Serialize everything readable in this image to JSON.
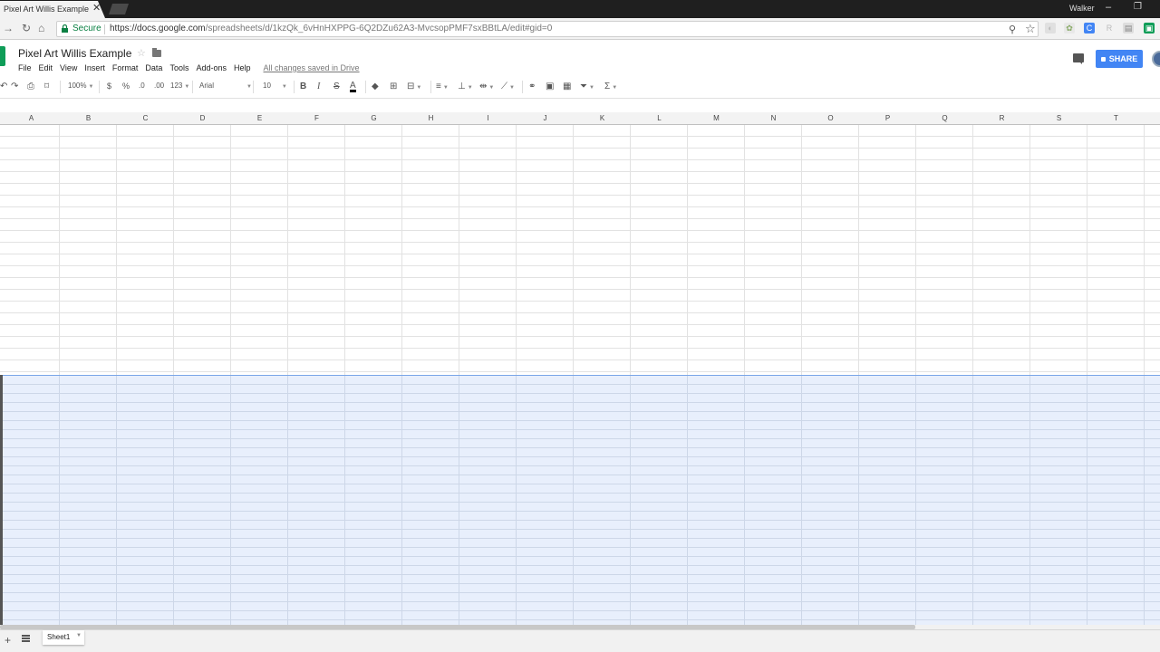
{
  "browser": {
    "tab_title": "Pixel Art Willis Example",
    "tab_close": "✕",
    "profile_name": "Walker",
    "secure_label": "Secure",
    "url_host": "https://docs.google.com",
    "url_path": "/spreadsheets/d/1kzQk_6vHnHXPPG-6Q2DZu62A3-MvcsopPMF7sxBBtLA/edit#gid=0",
    "extensions": [
      {
        "icon": "C",
        "color": "#4285f4"
      },
      {
        "icon": "R",
        "color": "#c8c8c8"
      },
      {
        "icon": "▣",
        "color": "#0f9d58"
      }
    ]
  },
  "doc": {
    "title": "Pixel Art Willis Example",
    "menus": [
      "File",
      "Edit",
      "View",
      "Insert",
      "Format",
      "Data",
      "Tools",
      "Add-ons",
      "Help"
    ],
    "save_status": "All changes saved in Drive",
    "share_label": "SHARE",
    "accent": "#4285f4",
    "brand": "#0f9d58"
  },
  "format_toolbar": {
    "zoom": "100%",
    "currency": "$",
    "percent": "%",
    "dec_decrease": ".0",
    "dec_increase": ".00",
    "more_formats": "123",
    "font": "Arial",
    "font_size": "10",
    "bold": "B",
    "italic": "I",
    "strike": "S",
    "text_color": "A",
    "sigma": "Σ"
  },
  "grid": {
    "columns": [
      "A",
      "B",
      "C",
      "D",
      "E",
      "F",
      "G",
      "H",
      "I",
      "J",
      "K",
      "L",
      "M",
      "N",
      "O",
      "P",
      "Q",
      "R",
      "S",
      "T"
    ],
    "selection_color": "#e8effc"
  },
  "sheets": {
    "add_symbol": "+",
    "tabs": [
      "Sheet1"
    ]
  }
}
